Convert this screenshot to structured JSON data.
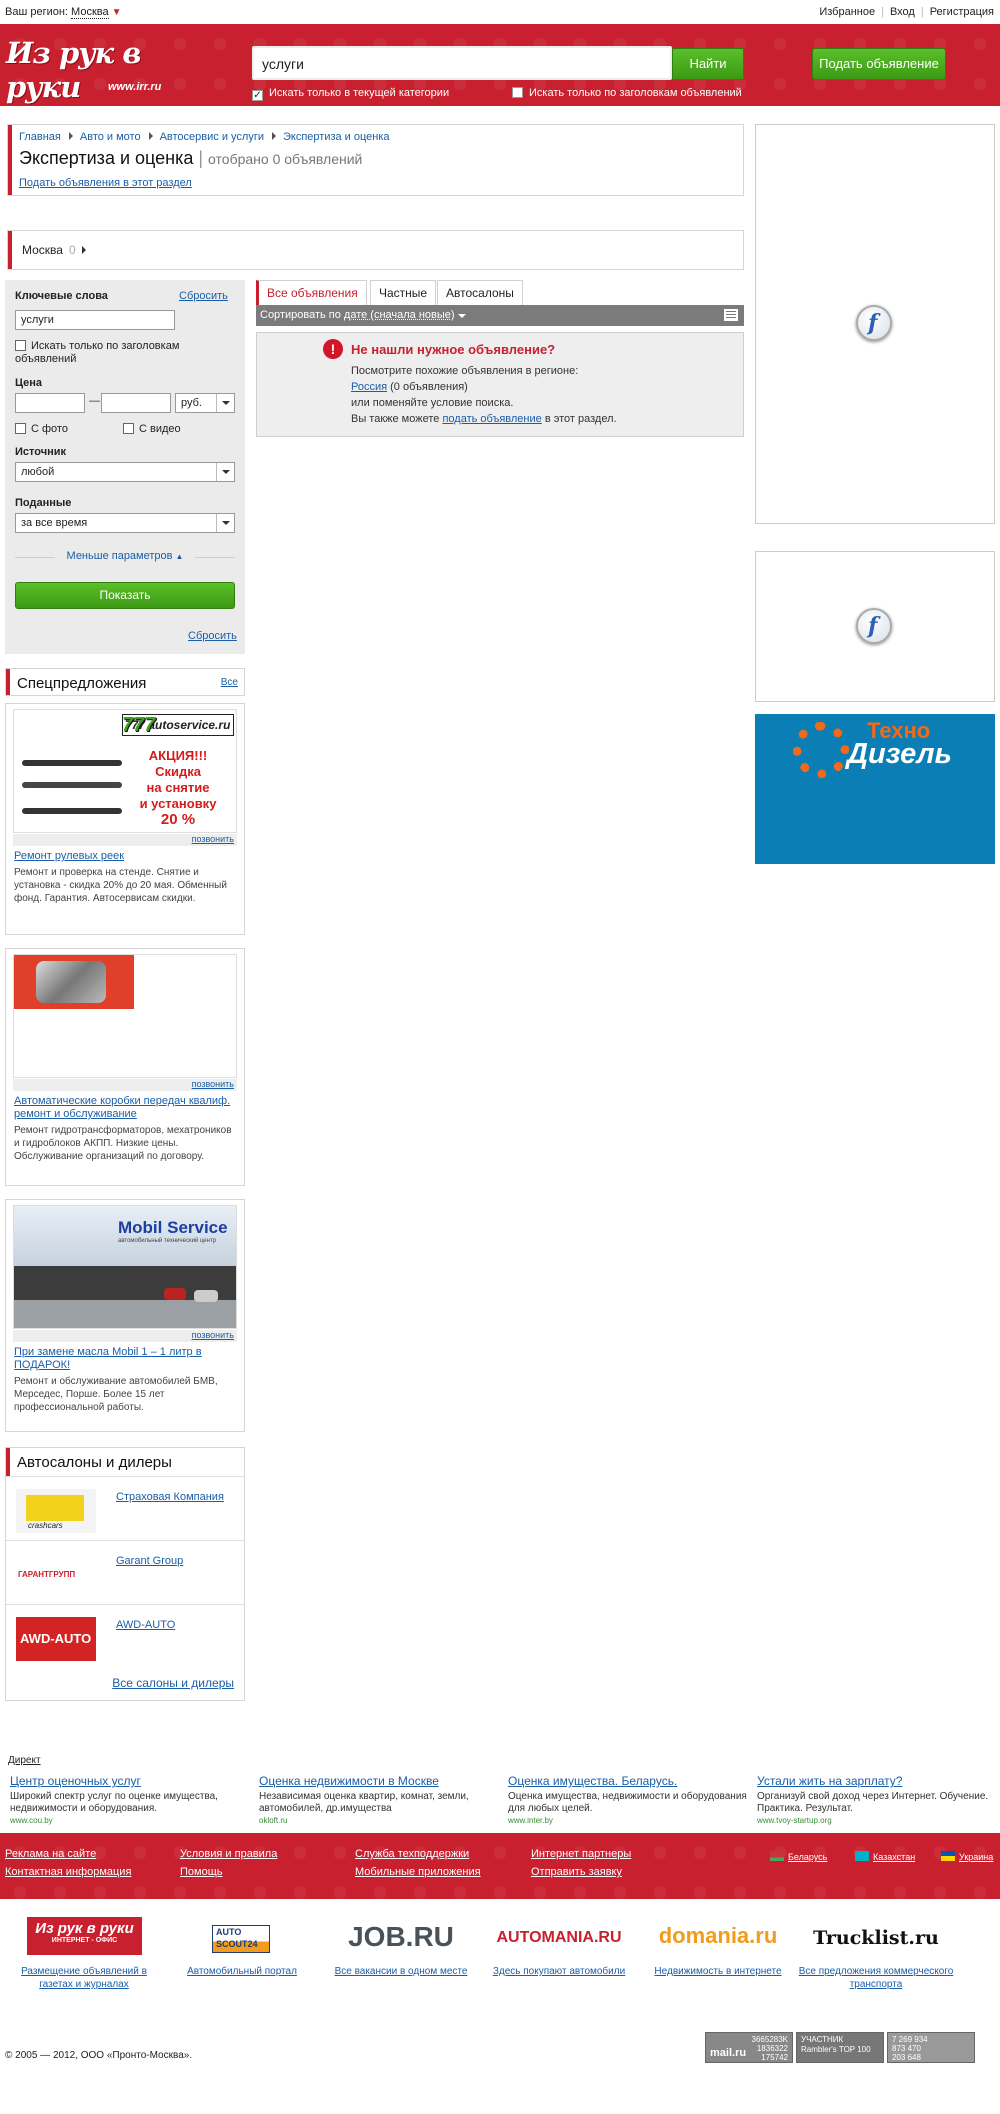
{
  "topbar": {
    "region_label": "Ваш регион:",
    "region_value": "Москва",
    "links": [
      "Избранное",
      "Вход",
      "Регистрация"
    ]
  },
  "header": {
    "logo_text": "Из рук в руки",
    "logo_url": "www.irr.ru",
    "search_value": "услуги",
    "search_button": "Найти",
    "post_button": "Подать объявление",
    "check_category": "Искать только в текущей категории",
    "check_titles": "Искать только по заголовкам объявлений"
  },
  "breadcrumb": {
    "items": [
      "Главная",
      "Авто и мото",
      "Автосервис и услуги",
      "Экспертиза и оценка"
    ],
    "title": "Экспертиза и оценка",
    "count": "отобрано 0 объявлений",
    "post_link": "Подать объявления в этот раздел"
  },
  "region": {
    "name": "Москва",
    "count": "0"
  },
  "filter": {
    "keywords_label": "Ключевые слова",
    "reset_top": "Сбросить",
    "keywords_value": "услуги",
    "titles_only": "Искать только по заголовкам объявлений",
    "price_label": "Цена",
    "price_dash": "—",
    "currency": "руб.",
    "with_photo": "С фото",
    "with_video": "С видео",
    "source_label": "Источник",
    "source_value": "любой",
    "posted_label": "Поданные",
    "posted_value": "за все время",
    "less_params": "Меньше параметров",
    "show_button": "Показать",
    "reset_bottom": "Сбросить"
  },
  "tabs": [
    "Все объявления",
    "Частные",
    "Автосалоны"
  ],
  "sort": {
    "prefix": "Сортировать по",
    "value": "дате (сначала новые)"
  },
  "notfound": {
    "title": "Не нашли нужное объявление?",
    "line1": "Посмотрите похожие объявления в регионе:",
    "russia_link": "Россия",
    "russia_count": "(0 объявления)",
    "line3": "или поменяйте условие поиска.",
    "line4_pre": "Вы также можете",
    "line4_link": "подать объявление",
    "line4_post": "в этот раздел."
  },
  "special": {
    "title": "Спецпредложения",
    "all": "Все",
    "offers": [
      {
        "img_brand": "777 autoservice.ru",
        "img_text": [
          "АКЦИЯ!!!",
          "Скидка",
          "на снятие",
          "и установку",
          "20 %"
        ],
        "call": "позвонить",
        "title": "Ремонт рулевых реек",
        "desc": "Ремонт и проверка на стенде. Снятие и установка - скидка 20% до 20 мая. Обменный фонд. Гарантия. Автосервисам скидки."
      },
      {
        "call": "позвонить",
        "title": "Автоматические коробки передач квалиф. ремонт и обслуживание",
        "desc": "Ремонт гидротрансформаторов, мехатроников и гидроблоков АКПП. Низкие цены. Обслуживание организаций по договору."
      },
      {
        "img_brand": "Mobil Service",
        "img_sub": "автомобильный технический центр",
        "call": "позвонить",
        "title": "При замене масла Mobil 1 – 1 литр в ПОДАРОК!",
        "desc": "Ремонт и обслуживание автомобилей БМВ, Мерседес, Порше. Более 15 лет профессиональной работы."
      }
    ]
  },
  "dealers": {
    "title": "Автосалоны и дилеры",
    "items": [
      {
        "name": "Страховая Компания",
        "logo": "crashcars"
      },
      {
        "name": "Garant Group",
        "logo": "ГАРАНТГРУПП"
      },
      {
        "name": "AWD-AUTO",
        "logo": "AWD-AUTO"
      }
    ],
    "all": "Все салоны и дилеры"
  },
  "banner": {
    "t1": "Техно",
    "t2": "Дизель"
  },
  "direct": {
    "label": "Директ",
    "ads": [
      {
        "title": "Центр оценочных услуг",
        "desc": "Широкий спектр услуг по оценке имущества, недвижимости и оборудования.",
        "site": "www.cou.by"
      },
      {
        "title": "Оценка недвижимости в Москве",
        "desc": "Независимая оценка квартир, комнат, земли, автомобилей, др.имущества",
        "site": "okloft.ru"
      },
      {
        "title": "Оценка имущества. Беларусь.",
        "desc": "Оценка имущества, недвижимости и оборудования для любых целей.",
        "site": "www.inter.by"
      },
      {
        "title": "Устали жить на зарплату?",
        "desc": "Организуй свой доход через Интернет. Обучение. Практика. Результат.",
        "site": "www.tvoy-startup.org"
      }
    ]
  },
  "footer": {
    "col1": [
      "Реклама на сайте",
      "Контактная информация"
    ],
    "col2": [
      "Условия и правила",
      "Помощь"
    ],
    "col3": [
      "Служба техподдержки",
      "Мобильные приложения"
    ],
    "col4": [
      "Интернет партнеры",
      "Отправить заявку"
    ],
    "countries": [
      "Беларусь",
      "Казахстан",
      "Украина"
    ]
  },
  "partners": [
    {
      "logo": "Из рук в руки",
      "logo_sub": "ИНТЕРНЕТ - ОФИС",
      "caption": "Размещение объявлений в газетах и журналах"
    },
    {
      "logo": "AUTO SCOUT24",
      "caption": "Автомобильный портал"
    },
    {
      "logo": "JOB.RU",
      "caption": "Все вакансии в одном месте"
    },
    {
      "logo": "AUTOMANIA.RU",
      "caption": "Здесь покупают автомобили"
    },
    {
      "logo": "domania.ru",
      "caption": "Недвижимость в интернете"
    },
    {
      "logo": "Trucklist.ru",
      "caption": "Все предложения коммерческого транспорта"
    }
  ],
  "copyright": "© 2005 — 2012, ООО «Пронто-Москва».",
  "counters": [
    {
      "label": "mail.ru",
      "nums": [
        "3665283K",
        "1836322",
        "175742"
      ]
    },
    {
      "label": "УЧАСТНИК Rambler's TOP 100"
    },
    {
      "nums": [
        "7 269 934",
        "873 470",
        "203 648"
      ]
    }
  ],
  "colors": {
    "brand_red": "#c8202e",
    "green": "#46a81c",
    "link": "#1a5ea8"
  }
}
